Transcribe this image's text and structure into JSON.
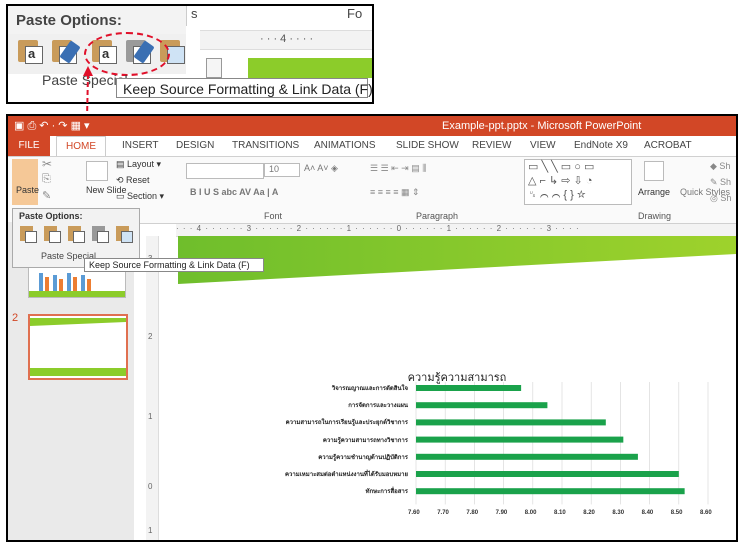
{
  "zoom": {
    "paste_title": "Paste Options:",
    "paste_special": "Paste Special",
    "tooltip": "Keep Source Formatting & Link Data (F)",
    "col_s": "s",
    "col_fo": "Fo",
    "ruler_text": "· · · 4 · · · ·"
  },
  "window": {
    "title": "Example-ppt.pptx - Microsoft PowerPoint",
    "tabs": [
      "FILE",
      "HOME",
      "INSERT",
      "DESIGN",
      "TRANSITIONS",
      "ANIMATIONS",
      "SLIDE SHOW",
      "REVIEW",
      "VIEW",
      "EndNote X9",
      "ACROBAT"
    ]
  },
  "ribbon": {
    "paste": "Paste",
    "new_slide": "New Slide",
    "layout": "Layout",
    "reset": "Reset",
    "section": "Section",
    "font_size": "10",
    "font_group": "Font",
    "paragraph_group": "Paragraph",
    "arrange": "Arrange",
    "quick_styles": "Quick Styles",
    "drawing_group": "Drawing",
    "s1": "Sh",
    "s2": "Sh",
    "s3": "Sh"
  },
  "popup": {
    "title": "Paste Options:",
    "special": "Paste Special",
    "tooltip": "Keep Source Formatting & Link Data (F)"
  },
  "thumbs": {
    "n1": "1",
    "n2": "2"
  },
  "chart_data": {
    "type": "bar",
    "title": "ความรู้ความสามารถ",
    "categories": [
      "วิจารณญาณและการตัดสินใจ",
      "การจัดการและวางแผน",
      "ความสามารถในการเรียนรู้และประยุกต์วิชาการ",
      "ความรู้ความสามารถทางวิชาการ",
      "ความรู้ความชำนาญด้านปฏิบัติการ",
      "ความเหมาะสมต่อตำแหน่งงานที่ได้รับมอบหมาย",
      "ทักษะการสื่อสาร"
    ],
    "values": [
      7.96,
      8.05,
      8.25,
      8.31,
      8.36,
      8.5,
      8.52
    ],
    "xlim": [
      7.6,
      8.6
    ],
    "ticks": [
      "7.60",
      "7.70",
      "7.80",
      "7.90",
      "8.00",
      "8.10",
      "8.20",
      "8.30",
      "8.40",
      "8.50",
      "8.60"
    ],
    "bar_color": "#1aa24b",
    "grid": true
  },
  "colors": {
    "accent": "#d24726",
    "green": "#8ccc2a"
  }
}
